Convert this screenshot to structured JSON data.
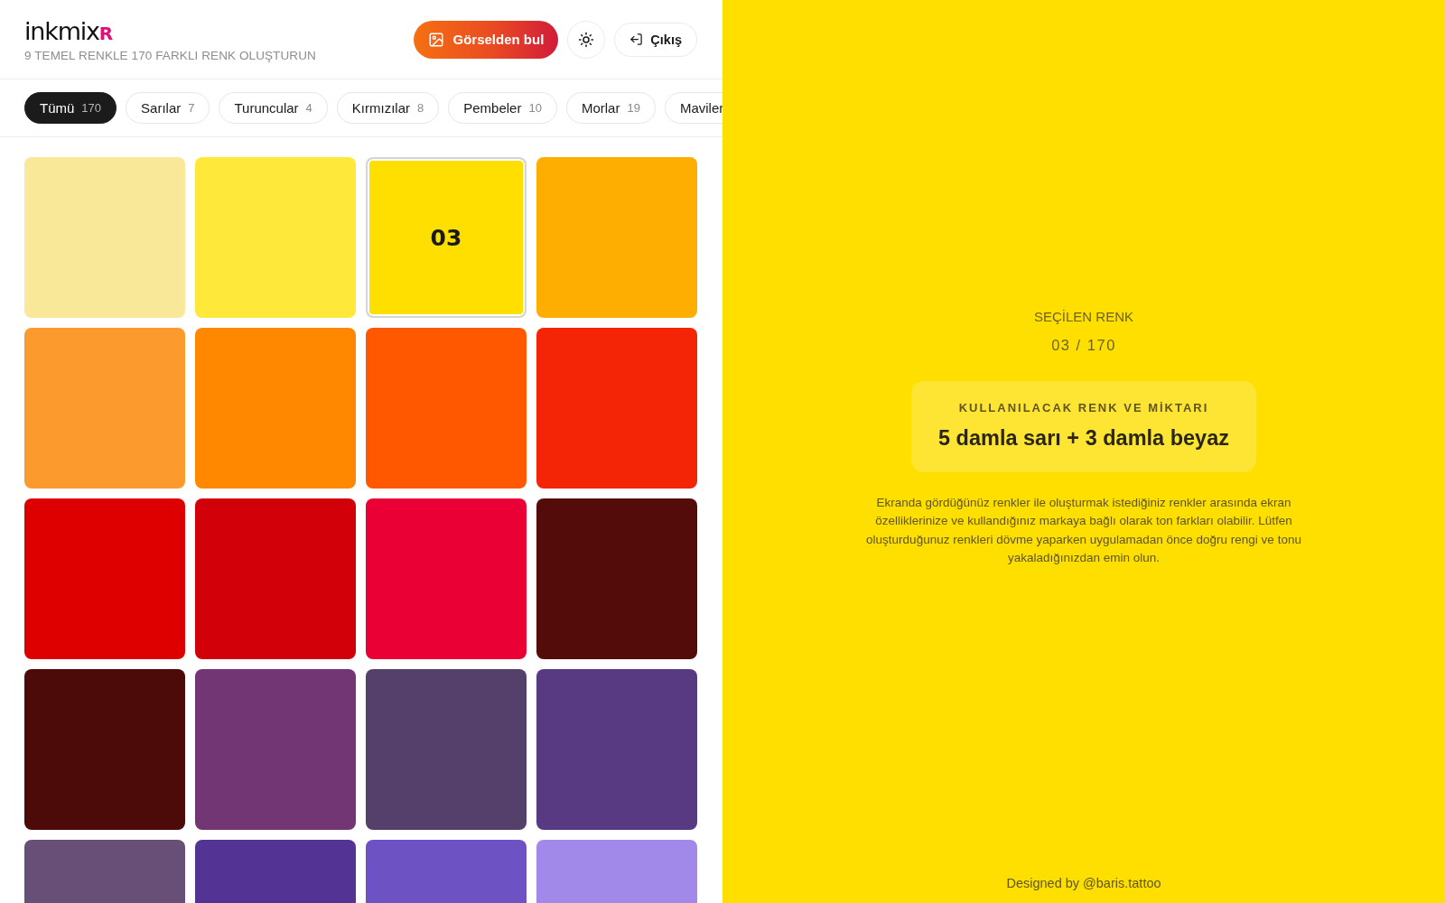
{
  "header": {
    "logo": {
      "text": "inkmix",
      "suffix": "R"
    },
    "tagline": "9 TEMEL RENKLE 170 FARKLI RENK OLUŞTURUN",
    "find_button": {
      "label": "Görselden bul"
    },
    "logout_button": {
      "label": "Çıkış"
    }
  },
  "filters": [
    {
      "label": "Tümü",
      "count": "170",
      "selected": true
    },
    {
      "label": "Sarılar",
      "count": "7",
      "selected": false
    },
    {
      "label": "Turuncular",
      "count": "4",
      "selected": false
    },
    {
      "label": "Kırmızılar",
      "count": "8",
      "selected": false
    },
    {
      "label": "Pembeler",
      "count": "10",
      "selected": false
    },
    {
      "label": "Morlar",
      "count": "19",
      "selected": false
    },
    {
      "label": "Maviler",
      "selected": false
    }
  ],
  "swatches": [
    {
      "color": "#f9e897",
      "selected": false
    },
    {
      "color": "#fee83a",
      "selected": false
    },
    {
      "color": "#ffdf00",
      "selected": true,
      "label": "03"
    },
    {
      "color": "#feae00",
      "selected": false
    },
    {
      "color": "#fc9a2e",
      "selected": false
    },
    {
      "color": "#ff8800",
      "selected": false
    },
    {
      "color": "#ff5800",
      "selected": false
    },
    {
      "color": "#f42506",
      "selected": false
    },
    {
      "color": "#de0000",
      "selected": false
    },
    {
      "color": "#d20008",
      "selected": false
    },
    {
      "color": "#ea0034",
      "selected": false
    },
    {
      "color": "#540c0b",
      "selected": false
    },
    {
      "color": "#4c0b09",
      "selected": false
    },
    {
      "color": "#733674",
      "selected": false
    },
    {
      "color": "#553f6b",
      "selected": false
    },
    {
      "color": "#583a82",
      "selected": false
    },
    {
      "color": "#674f77",
      "selected": false
    },
    {
      "color": "#533394",
      "selected": false
    },
    {
      "color": "#6d52c4",
      "selected": false
    },
    {
      "color": "#a089e8",
      "selected": false
    }
  ],
  "detail": {
    "heading": "SEÇİLEN RENK",
    "position": "03 / 170",
    "recipe": {
      "title": "KULLANILACAK RENK VE MİKTARI",
      "value": "5 damla sarı + 3 damla beyaz"
    },
    "note": "Ekranda gördüğünüz renkler ile oluşturmak istediğiniz renkler arasında ekran özelliklerinize ve kullandığınız markaya bağlı olarak ton farkları olabilir. Lütfen oluşturduğunuz renkleri dövme yaparken uygulamadan önce doğru rengi ve tonu yakaladığınızdan emin olun.",
    "footer": "Designed by @baris.tattoo"
  }
}
